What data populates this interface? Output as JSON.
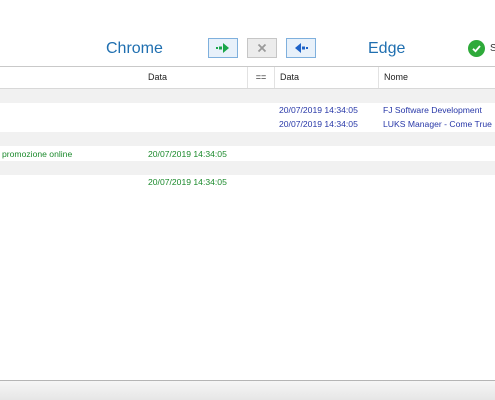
{
  "header": {
    "left_browser": "Chrome",
    "right_browser": "Edge",
    "status_label": "S"
  },
  "toolbar": {
    "copy_right_icon": "arrow-right-icon",
    "delete_icon": "x-icon",
    "copy_left_icon": "arrow-left-icon",
    "accent_color": "#1f6fb0",
    "arrow_color": "#1aa64a",
    "arrow_left_color": "#1f63c8"
  },
  "grid": {
    "columns": {
      "left_date": "Data",
      "compare": "==",
      "right_date": "Data",
      "right_name": "Nome"
    },
    "rows": [
      {
        "kind": "group"
      },
      {
        "kind": "item",
        "color": "blue",
        "right_date": "20/07/2019 14:34:05",
        "right_name": "FJ Software Development"
      },
      {
        "kind": "item",
        "color": "blue",
        "right_date": "20/07/2019 14:34:05",
        "right_name": "LUKS Manager - Come True"
      },
      {
        "kind": "group"
      },
      {
        "kind": "item",
        "color": "green",
        "left_name": "promozione online",
        "left_date": "20/07/2019 14:34:05"
      },
      {
        "kind": "group"
      },
      {
        "kind": "item",
        "color": "green",
        "left_date": "20/07/2019 14:34:05"
      }
    ]
  }
}
